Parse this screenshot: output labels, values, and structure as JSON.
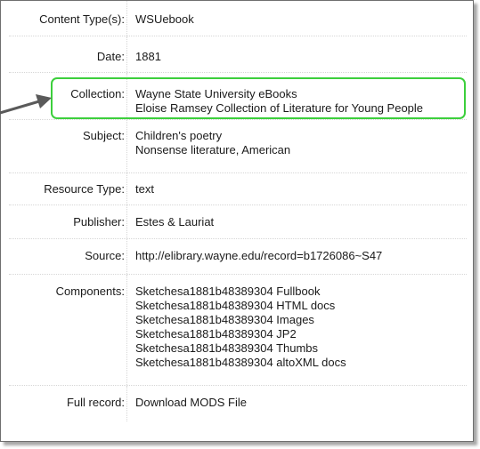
{
  "record": {
    "content_type": {
      "label": "Content Type(s):",
      "values": [
        "WSUebook"
      ]
    },
    "date": {
      "label": "Date:",
      "values": [
        "1881"
      ]
    },
    "collection": {
      "label": "Collection:",
      "values": [
        "Wayne State University eBooks",
        "Eloise Ramsey Collection of Literature for Young People"
      ]
    },
    "subject": {
      "label": "Subject:",
      "values": [
        "Children's poetry",
        "Nonsense literature, American"
      ]
    },
    "resource_type": {
      "label": "Resource Type:",
      "values": [
        "text"
      ]
    },
    "publisher": {
      "label": "Publisher:",
      "values": [
        "Estes & Lauriat"
      ]
    },
    "source": {
      "label": "Source:",
      "values": [
        "http://elibrary.wayne.edu/record=b1726086~S47"
      ]
    },
    "components": {
      "label": "Components:",
      "values": [
        "Sketchesa1881b48389304 Fullbook",
        "Sketchesa1881b48389304 HTML docs",
        "Sketchesa1881b48389304 Images",
        "Sketchesa1881b48389304 JP2",
        "Sketchesa1881b48389304 Thumbs",
        "Sketchesa1881b48389304 altoXML docs"
      ]
    },
    "full_record": {
      "label": "Full record:",
      "values": [
        "Download MODS File"
      ]
    }
  },
  "annotation": {
    "highlight_color": "#3ccf3c",
    "arrow_color": "#5a5a5a",
    "arrow_icon": "arrow-right-icon"
  }
}
